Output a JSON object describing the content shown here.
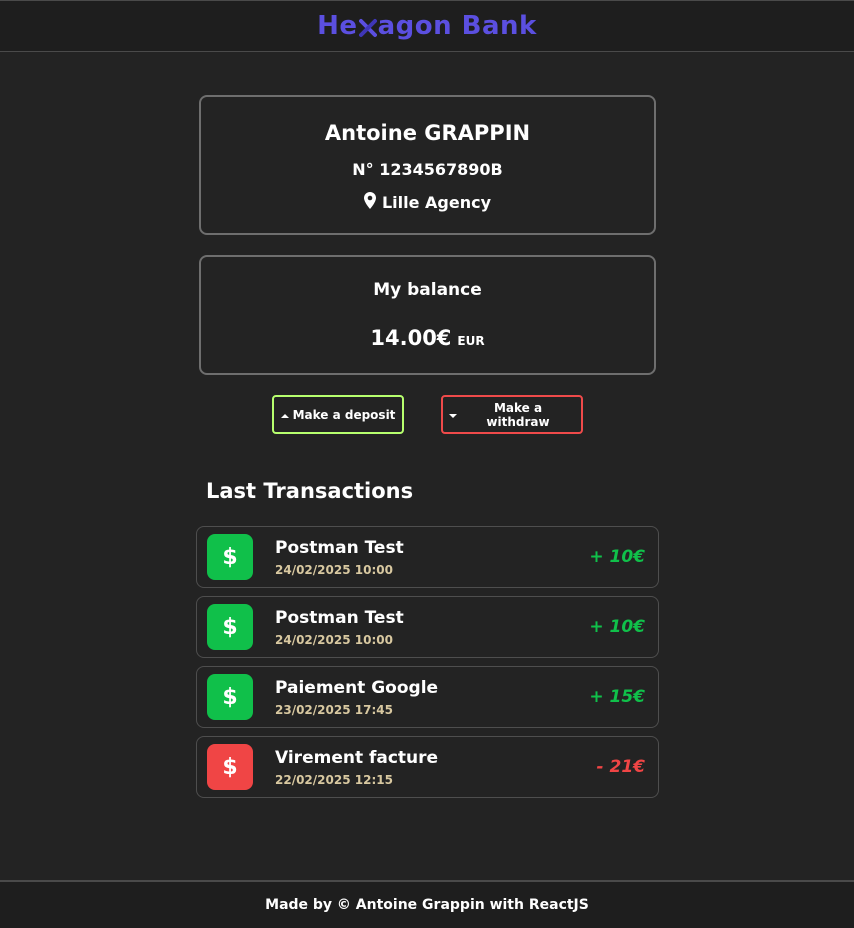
{
  "header": {
    "brand_prefix": "He",
    "brand_suffix": "agon Bank",
    "brand_color": "#5b4fe0"
  },
  "profile": {
    "name": "Antoine GRAPPIN",
    "account_number": "N° 1234567890B",
    "agency": "Lille Agency",
    "agency_icon": "map-marker-icon"
  },
  "balance": {
    "title": "My balance",
    "amount": "14.00€",
    "currency": "EUR"
  },
  "actions": {
    "deposit_label": "Make a deposit",
    "deposit_icon": "caret-up-icon",
    "deposit_color": "#b7ff6e",
    "withdraw_label": "Make a withdraw",
    "withdraw_icon": "caret-down-icon",
    "withdraw_color": "#ef4a4a"
  },
  "transactions": {
    "title": "Last Transactions",
    "icon_glyph": "$",
    "items": [
      {
        "label": "Postman Test",
        "date": "24/02/2025 10:00",
        "amount": "+ 10€",
        "type": "credit"
      },
      {
        "label": "Postman Test",
        "date": "24/02/2025 10:00",
        "amount": "+ 10€",
        "type": "credit"
      },
      {
        "label": "Paiement Google",
        "date": "23/02/2025 17:45",
        "amount": "+ 15€",
        "type": "credit"
      },
      {
        "label": "Virement facture",
        "date": "22/02/2025 12:15",
        "amount": "- 21€",
        "type": "debit"
      }
    ],
    "credit_color": "#10c04a",
    "debit_color": "#f04545"
  },
  "footer": {
    "text": "Made by © Antoine Grappin with ReactJS"
  }
}
